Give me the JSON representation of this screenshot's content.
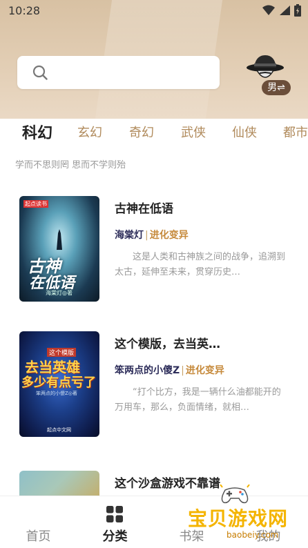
{
  "status": {
    "time": "10:28"
  },
  "search": {
    "placeholder": ""
  },
  "profile": {
    "gender_label": "男⇌"
  },
  "tabs": [
    {
      "label": "科幻",
      "active": true
    },
    {
      "label": "玄幻"
    },
    {
      "label": "奇幻"
    },
    {
      "label": "武侠"
    },
    {
      "label": "仙侠"
    },
    {
      "label": "都市"
    }
  ],
  "motto": "学而不思则罔 思而不学则殆",
  "books": [
    {
      "title": "古神在低语",
      "author": "海棠灯",
      "separator": "|",
      "genre": "进化变异",
      "desc": "这是人类和古神族之间的战争，追溯到太古，延伸至未来，贯穿历史…",
      "cover_publisher": "起点读书",
      "cover_title_line1": "古神",
      "cover_title_line2": "在低语",
      "cover_author": "海棠灯◎著",
      "cover_colors": [
        "#1b3a52",
        "#3f8ea8"
      ]
    },
    {
      "title": "这个模版，去当英…",
      "author": "笨两点的小傻Z",
      "separator": "|",
      "genre": "进化变异",
      "desc": "“打个比方，我是一辆什么油都能开的万用车，那么，负面情绪，就相…",
      "cover_tag": "这个模版",
      "cover_title_line1": "去当英雄",
      "cover_title_line2": "多少有点亏了",
      "cover_author": "笨两点的小傻Z◎著",
      "cover_publisher": "起点中文网",
      "cover_colors": [
        "#0e1b4a",
        "#1c3f8a"
      ]
    },
    {
      "title": "这个沙盒游戏不靠谱",
      "cover_colors": [
        "#8fc0c8",
        "#c2b070"
      ]
    }
  ],
  "nav": [
    {
      "label": "首页",
      "icon": "home-icon"
    },
    {
      "label": "分类",
      "icon": "grid-icon",
      "active": true
    },
    {
      "label": "书架",
      "icon": "bookshelf-icon"
    },
    {
      "label": "我的",
      "icon": "profile-icon"
    }
  ],
  "watermark": {
    "text": "宝贝游戏网",
    "url": "baobeiy.com"
  }
}
